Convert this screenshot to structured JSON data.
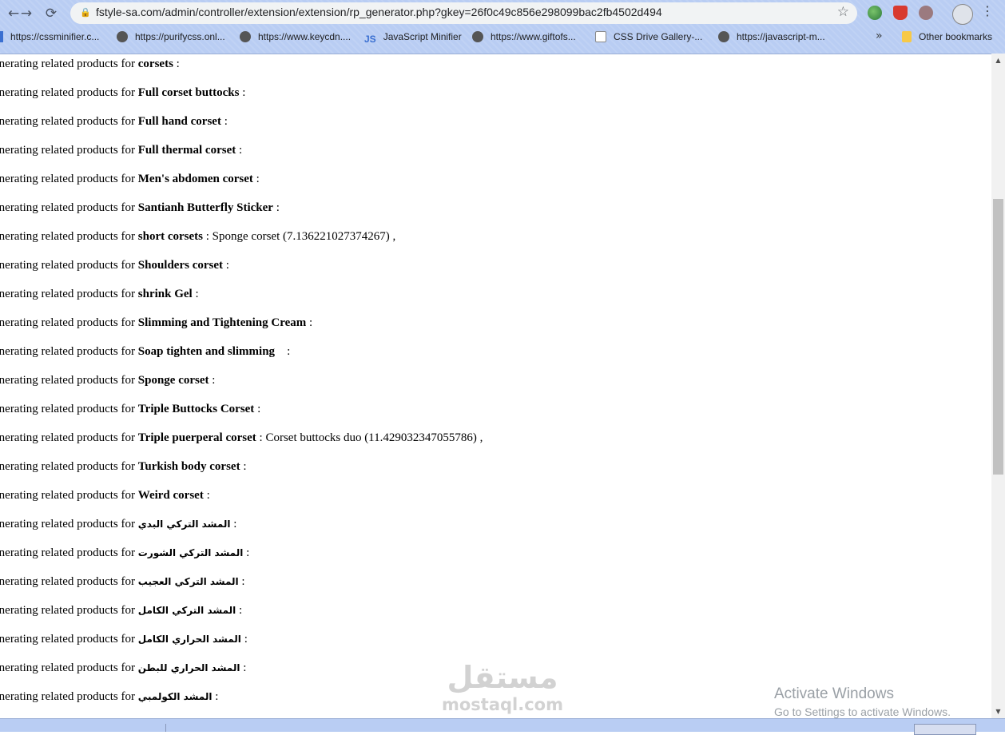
{
  "browser": {
    "url": "fstyle-sa.com/admin/controller/extension/extension/rp_generator.php?gkey=26f0c49c856e298099bac2fb4502d494",
    "back_icon": "arrow-left-icon",
    "forward_icon": "arrow-right-icon",
    "reload_icon": "reload-icon",
    "back_glyph": "←",
    "forward_glyph": "→",
    "reload_glyph": "⟳",
    "lock_glyph": "🔒",
    "star_glyph": "☆",
    "menu_glyph": "⋮",
    "bookmarks": [
      {
        "label": "https://cssminifier.c...",
        "icon": "css-icon"
      },
      {
        "label": "https://purifycss.onl...",
        "icon": "globe-icon"
      },
      {
        "label": "https://www.keycdn....",
        "icon": "globe-icon"
      },
      {
        "label": "JavaScript Minifier",
        "icon": "js-icon"
      },
      {
        "label": "https://www.giftofs...",
        "icon": "globe-icon"
      },
      {
        "label": "CSS Drive Gallery-...",
        "icon": "cssdrive-icon"
      },
      {
        "label": "https://javascript-m...",
        "icon": "globe-icon"
      }
    ],
    "more_bookmarks": "»",
    "other_bookmarks": "Other bookmarks",
    "colors": {
      "chrome": "#b9cdf3",
      "omnibox": "#f1f3f4"
    }
  },
  "page": {
    "prefix": "enerating related products for ",
    "lines": [
      {
        "product": "corsets",
        "result": " :"
      },
      {
        "product": "Full corset buttocks",
        "result": " :"
      },
      {
        "product": "Full hand corset",
        "result": " :"
      },
      {
        "product": "Full thermal corset",
        "result": " :"
      },
      {
        "product": "Men's abdomen corset",
        "result": " :"
      },
      {
        "product": "Santianh Butterfly Sticker",
        "result": " :"
      },
      {
        "product": "short corsets",
        "result": " : Sponge corset (7.136221027374267) ,"
      },
      {
        "product": "Shoulders corset",
        "result": " :"
      },
      {
        "product": "shrink Gel",
        "result": " :"
      },
      {
        "product": "Slimming and Tightening Cream",
        "result": " :"
      },
      {
        "product": "Soap tighten and slimming",
        "result": "    :"
      },
      {
        "product": "Sponge corset",
        "result": " :"
      },
      {
        "product": "Triple Buttocks Corset",
        "result": " :"
      },
      {
        "product": "Triple puerperal corset",
        "result": " : Corset buttocks duo (11.429032347055786) ,"
      },
      {
        "product": "Turkish body corset",
        "result": " :"
      },
      {
        "product": "Weird corset",
        "result": " :"
      },
      {
        "product": "المشد التركي البدي",
        "result": " :",
        "rtl": true
      },
      {
        "product": "المشد التركي الشورت",
        "result": " :",
        "rtl": true
      },
      {
        "product": "المشد التركي العجيب",
        "result": " :",
        "rtl": true
      },
      {
        "product": "المشد التركي الكامل",
        "result": " :",
        "rtl": true
      },
      {
        "product": "المشد الحراري الكامل",
        "result": " :",
        "rtl": true
      },
      {
        "product": "المشد الحراري للبطن",
        "result": " :",
        "rtl": true
      },
      {
        "product": "المشد الكولمبي",
        "result": " :",
        "rtl": true
      }
    ]
  },
  "scrollbar": {
    "up": "▲",
    "down": "▼"
  },
  "watermark": {
    "arabic": "مستقل",
    "latin": "mostaql.com"
  },
  "windows_notice": {
    "title": "Activate Windows",
    "subtitle": "Go to Settings to activate Windows."
  }
}
